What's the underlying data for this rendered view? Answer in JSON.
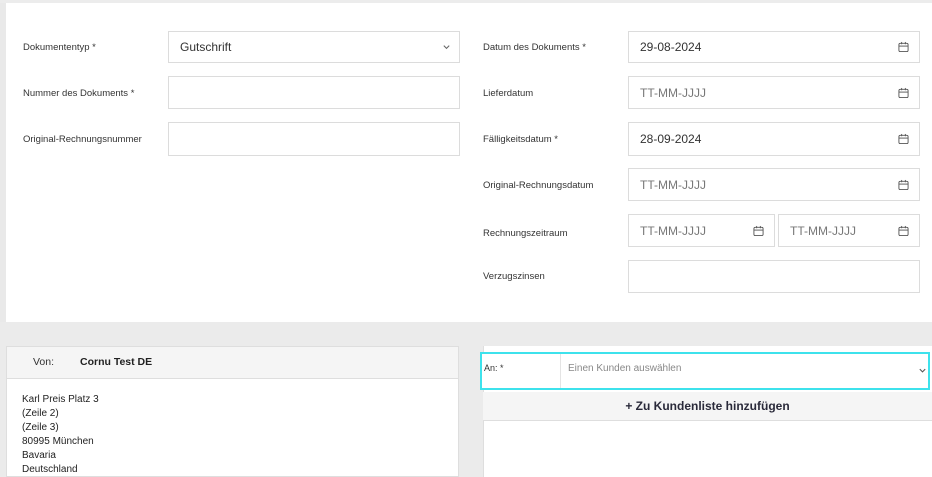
{
  "form": {
    "left": {
      "document_type_label": "Dokumententyp *",
      "document_type_value": "Gutschrift",
      "document_number_label": "Nummer des Dokuments *",
      "document_number_value": "",
      "original_invoice_number_label": "Original-Rechnungsnummer",
      "original_invoice_number_value": ""
    },
    "right": {
      "document_date_label": "Datum des Dokuments *",
      "document_date_value": "29-08-2024",
      "delivery_date_label": "Lieferdatum",
      "delivery_date_placeholder": "TT-MM-JJJJ",
      "due_date_label": "Fälligkeitsdatum *",
      "due_date_value": "28-09-2024",
      "original_invoice_date_label": "Original-Rechnungsdatum",
      "original_invoice_date_placeholder": "TT-MM-JJJJ",
      "invoice_period_label": "Rechnungszeitraum",
      "invoice_period_from_placeholder": "TT-MM-JJJJ",
      "invoice_period_to_placeholder": "TT-MM-JJJJ",
      "late_interest_label": "Verzugszinsen",
      "late_interest_value": ""
    }
  },
  "sender": {
    "label": "Von:",
    "name": "Cornu Test DE",
    "address_lines": [
      "Karl Preis Platz 3",
      "(Zeile 2)",
      "(Zeile 3)",
      "80995 München",
      "Bavaria",
      "Deutschland"
    ]
  },
  "recipient": {
    "label": "An: *",
    "select_placeholder": "Einen Kunden auswählen",
    "add_button_label": "+ Zu Kundenliste hinzufügen"
  },
  "colors": {
    "highlight": "#3ee2ec",
    "border": "#dcdcdc",
    "background": "#ebebeb"
  },
  "icons": {
    "calendar": "calendar-icon",
    "dropdown": "chevron-down-icon"
  }
}
